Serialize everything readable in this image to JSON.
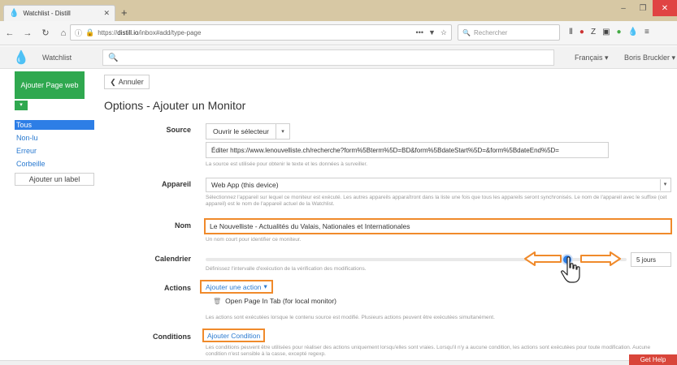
{
  "browser": {
    "tab_title": "Watchlist - Distill",
    "tab_close": "✕",
    "new_tab": "+",
    "url_prefix": "https://",
    "url_host": "distill.io",
    "url_path": "/inbox#add/type-page",
    "url_more": "•••",
    "search_placeholder": "Rechercher",
    "window_buttons": [
      "–",
      "❐",
      "✕"
    ],
    "toolbar_icons": [
      "library-icon",
      "pocket-icon",
      "zotero-icon",
      "screenshot-icon",
      "extension-icon",
      "distill-icon",
      "menu-icon"
    ]
  },
  "header": {
    "title": "Watchlist",
    "language": "Français ▾",
    "user": "Boris Bruckler ▾"
  },
  "sidebar": {
    "add_page_label": "Ajouter Page web",
    "filters": [
      "Tous",
      "Non-lu",
      "Erreur",
      "Corbeille"
    ],
    "add_label": "Ajouter un label"
  },
  "main": {
    "cancel_label": "Annuler",
    "title": "Options - Ajouter un Monitor",
    "source": {
      "label": "Source",
      "opener": "Ouvrir le sélecteur",
      "url": "Éditer https://www.lenouvelliste.ch/recherche?form%5Bterm%5D=BD&form%5BdateStart%5D=&form%5BdateEnd%5D=",
      "help": "La source est utilisée pour obtenir le texte et les données à surveiller."
    },
    "device": {
      "label": "Appareil",
      "value": "Web App (this device)",
      "help": "Sélectionnez l'appareil sur lequel ce moniteur est exécuté. Les autres appareils apparaîtront dans la liste une fois que tous les appareils seront synchronisés. Le nom de l'appareil avec le suffixe (cet appareil) est le nom de l'appareil actuel de la Watchlist."
    },
    "name": {
      "label": "Nom",
      "value": "Le Nouvelliste - Actualités du Valais, Nationales et Internationales",
      "help": "Un nom court pour identifier ce moniteur."
    },
    "schedule": {
      "label": "Calendrier",
      "value": "5 jours",
      "slider_level": 0.86,
      "help": "Définissez l'intervalle d'exécution de la vérification des modifications."
    },
    "actions": {
      "label": "Actions",
      "add_label": "Ajouter une action",
      "items": [
        "Open Page In Tab (for local monitor)"
      ],
      "help": "Les actions sont exécutées lorsque le contenu source est modifié. Plusieurs actions peuvent être exécutées simultanément."
    },
    "conditions": {
      "label": "Conditions",
      "add_label": "Ajouter Condition",
      "help": "Les conditions peuvent être utilisées pour réaliser des actions uniquement lorsqu'elles sont vraies. Lorsqu'il n'y a aucune condition, les actions sont exécutées pour toute modification. Aucune condition n'est sensible à la casse, excepté regexp."
    }
  },
  "help_button": "Get Help",
  "colors": {
    "accent_green": "#2fa84f",
    "accent_blue": "#2d7ee6",
    "highlight_orange": "#f08a2b"
  }
}
